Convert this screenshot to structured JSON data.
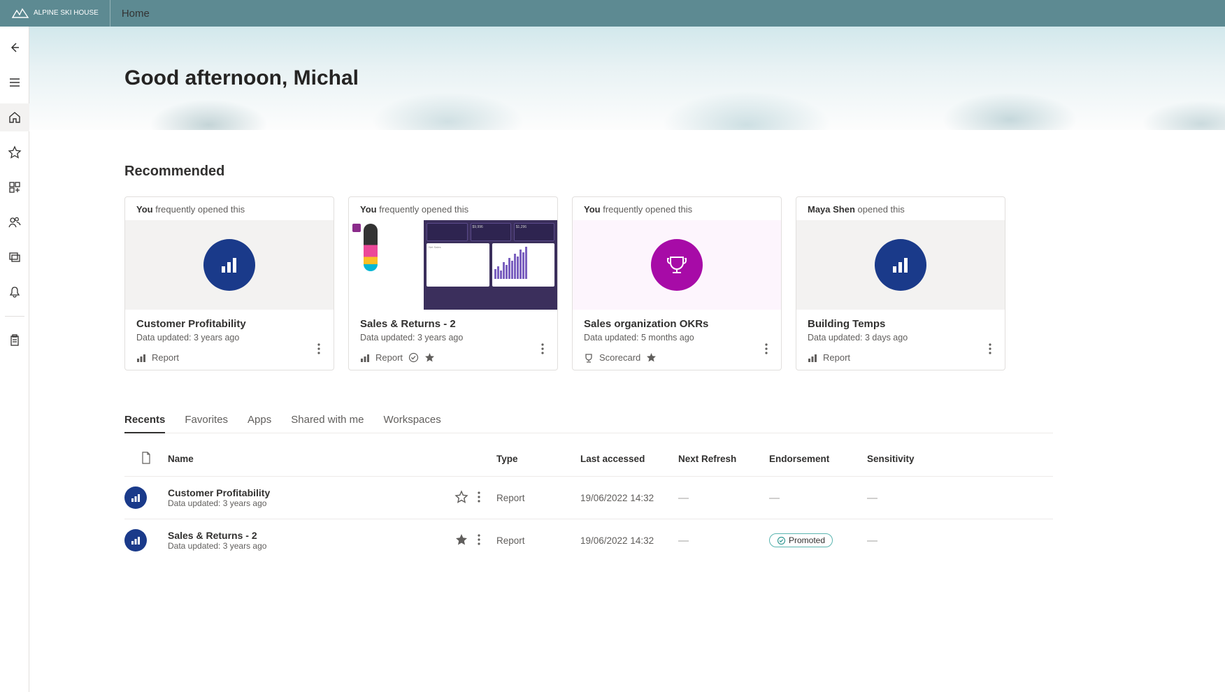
{
  "topbar": {
    "brand": "ALPINE SKI HOUSE",
    "home": "Home"
  },
  "hero": {
    "greeting": "Good afternoon, Michal"
  },
  "recommended": {
    "title": "Recommended",
    "cards": [
      {
        "who": "You",
        "action": "frequently opened this",
        "title": "Customer Profitability",
        "updated": "Data updated: 3 years ago",
        "type_label": "Report"
      },
      {
        "who": "You",
        "action": "frequently opened this",
        "title": "Sales & Returns  - 2",
        "updated": "Data updated: 3 years ago",
        "type_label": "Report"
      },
      {
        "who": "You",
        "action": "frequently opened this",
        "title": "Sales organization OKRs",
        "updated": "Data updated: 5 months ago",
        "type_label": "Scorecard"
      },
      {
        "who": "Maya Shen",
        "action": "opened this",
        "title": "Building Temps",
        "updated": "Data updated: 3 days ago",
        "type_label": "Report"
      }
    ]
  },
  "tabs": [
    "Recents",
    "Favorites",
    "Apps",
    "Shared with me",
    "Workspaces"
  ],
  "table": {
    "headers": {
      "name": "Name",
      "type": "Type",
      "last": "Last accessed",
      "refresh": "Next Refresh",
      "endorse": "Endorsement",
      "sens": "Sensitivity"
    },
    "rows": [
      {
        "name": "Customer Profitability",
        "sub": "Data updated: 3 years ago",
        "type": "Report",
        "last": "19/06/2022 14:32",
        "refresh": "—",
        "endorse": "—",
        "sens": "—",
        "starred": false
      },
      {
        "name": "Sales & Returns  - 2",
        "sub": "Data updated: 3 years ago",
        "type": "Report",
        "last": "19/06/2022 14:32",
        "refresh": "—",
        "endorse_badge": "Promoted",
        "sens": "—",
        "starred": true
      }
    ]
  }
}
